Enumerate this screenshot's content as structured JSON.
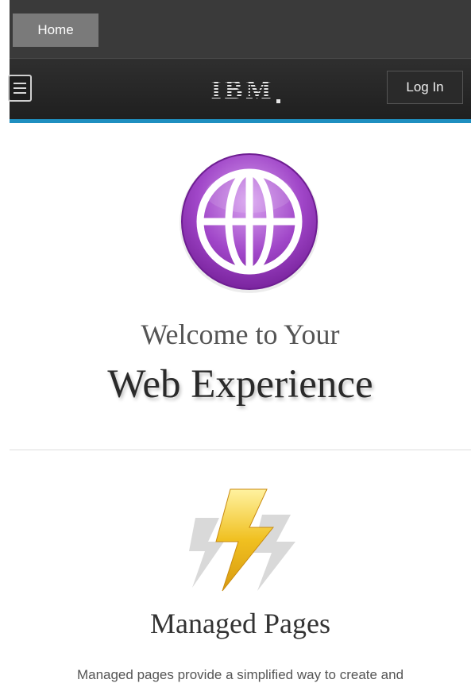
{
  "topbar": {
    "home_tab": "Home"
  },
  "navbar": {
    "menu_icon": "hamburger-menu-icon",
    "logo_text": "IBM",
    "login_label": "Log In"
  },
  "hero": {
    "icon": "globe-icon",
    "line1": "Welcome to Your",
    "line2": "Web Experience"
  },
  "section": {
    "icon": "lightning-bolt-icon",
    "title": "Managed Pages",
    "description": "Managed pages provide a simplified way to create and"
  },
  "colors": {
    "accent": "#1f8fc0",
    "globe": "#a046c8",
    "bolt": "#f0c020"
  }
}
